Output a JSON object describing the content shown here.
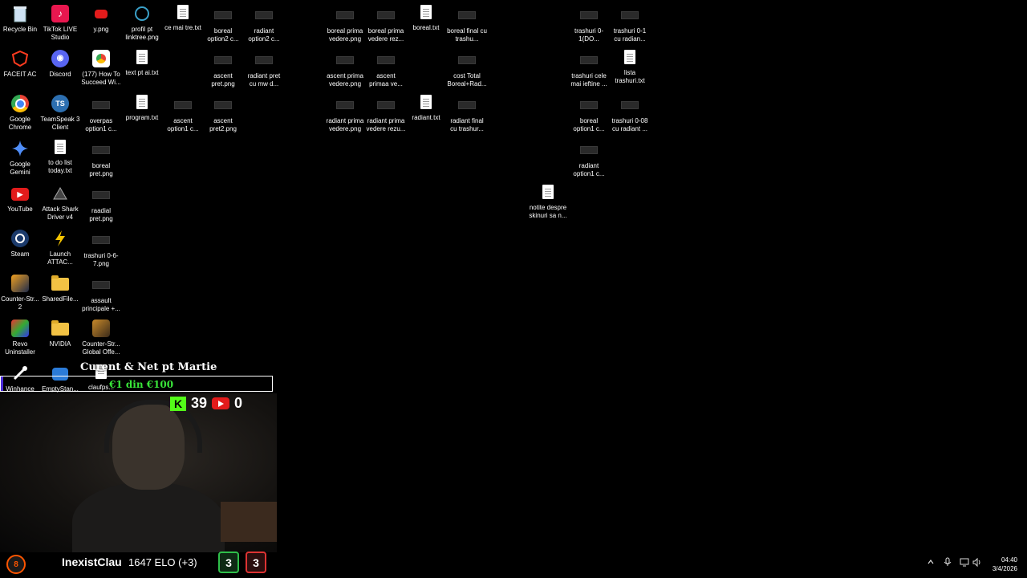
{
  "desktop": {
    "icons": {
      "recycle_bin": "Recycle Bin",
      "tiktok": "TikTok LIVE Studio",
      "y_png": "y.png",
      "profil": "profil pt linktree.png",
      "ce_mai": "ce mai tre.txt",
      "boreal_opt2": "boreal option2 c...",
      "radiant_opt2": "radiant option2 c...",
      "boreal_prima": "boreal prima vedere.png",
      "boreal_prima_rez": "boreal prima vedere rez...",
      "boreal_txt": "boreal.txt",
      "boreal_final": "boreal final cu trashu...",
      "trashuri_01_do": "trashuri 0-1(DO...",
      "trashuri_01_radian": "trashuri 0-1 cu radian...",
      "faceit": "FACEIT AC",
      "discord": "Discord",
      "how_to": "(177) How To Succeed Wi...",
      "text_pt_ai": "text pt ai.txt",
      "ascent_pret": "ascent pret.png",
      "radiant_pret": "radiant pret cu mw d...",
      "ascent_prima": "ascent prima vedere.png",
      "ascent_primaa": "ascent primaa ve...",
      "cost_total": "cost Total Boreal+Rad...",
      "trashuri_ieftine": "trashuri cele mai ieftine ...",
      "lista_trashuri": "lista trashuri.txt",
      "chrome": "Google Chrome",
      "teamspeak": "TeamSpeak 3 Client",
      "overpas": "overpas option1 c...",
      "program": "program.txt",
      "ascent_opt1": "ascent option1 c...",
      "ascent_pret2": "ascent pret2.png",
      "radiant_prima": "radiant prima vedere.png",
      "radiant_prima_rez": "radiant prima vedere rezu...",
      "radiant_txt": "radiant.txt",
      "radiant_final": "radiant final cu trashur...",
      "boreal_opt1": "boreal option1 c...",
      "trashuri_008": "trashuri 0-08 cu radiant ...",
      "gemini": "Google Gemini",
      "todo": "to do list today.txt",
      "boreal_pret": "boreal pret.png",
      "radiant_opt1": "radiant option1 c...",
      "youtube": "YouTube",
      "attack_shark": "Attack Shark Driver v4",
      "raadial": "raadial pret.png",
      "notite": "notite despre skinuri sa n...",
      "steam": "Steam",
      "launch_attac": "Launch ATTAC...",
      "trashuri_067": "trashuri 0-6-7.png",
      "cs2": "Counter-Str... 2",
      "sharedfile": "SharedFile...",
      "assault": "assault principale +...",
      "revo": "Revo Uninstaller",
      "nvidia": "NVIDIA",
      "csgo": "Counter-Str... Global Offe...",
      "winhance": "Winhance",
      "emptystan": "EmptyStan...",
      "claufps": "claufps..."
    }
  },
  "overlay": {
    "goal_title": "Curent & Net pt Martie",
    "goal_text": "€1 din €100",
    "goal_progress": 0.01,
    "kick_count": "39",
    "youtube_count": "0"
  },
  "scoreboard": {
    "faceit_level": "8",
    "player": "InexistClau",
    "elo": "1647 ELO (+3)",
    "wins": "3",
    "losses": "3"
  },
  "taskbar": {
    "time": "04:40",
    "date": "3/4/2026"
  },
  "colors": {
    "goal_fill": "#4a2bd6",
    "goal_text": "#39e639",
    "kick": "#53fc18",
    "youtube": "#e21b1b",
    "faceit": "#ff5500"
  }
}
